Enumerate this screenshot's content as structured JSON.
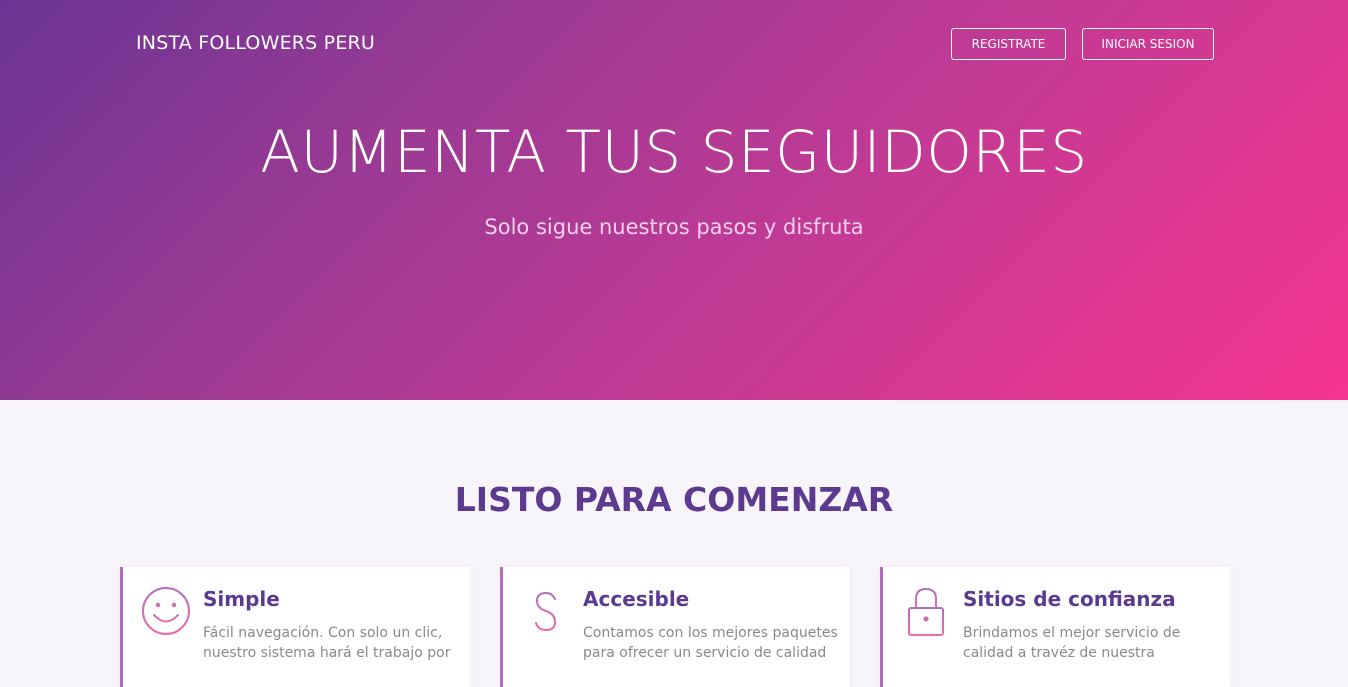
{
  "header": {
    "brand": "INSTA FOLLOWERS PERU",
    "register_label": "REGISTRATE",
    "login_label": "INICIAR SESION"
  },
  "hero": {
    "title": "AUMENTA TUS SEGUIDORES",
    "subtitle": "Solo sigue nuestros pasos y disfruta"
  },
  "section": {
    "title": "LISTO PARA COMENZAR"
  },
  "features": [
    {
      "icon": "smiley-icon",
      "title": "Simple",
      "text": "Fácil navegación. Con solo un clic, nuestro sistema hará el trabajo por"
    },
    {
      "icon": "dollar-icon",
      "title": "Accesible",
      "text": "Contamos con los mejores paquetes para ofrecer un servicio de calidad"
    },
    {
      "icon": "lock-icon",
      "title": "Sitios de confianza",
      "text": "Brindamos el mejor servicio de calidad a travéz de nuestra"
    }
  ],
  "colors": {
    "gradient_start": "#6a3494",
    "gradient_end": "#f5348f",
    "heading": "#5b3a90",
    "icon_gradient_top": "#b26dbf",
    "icon_gradient_bottom": "#f06aa6"
  }
}
